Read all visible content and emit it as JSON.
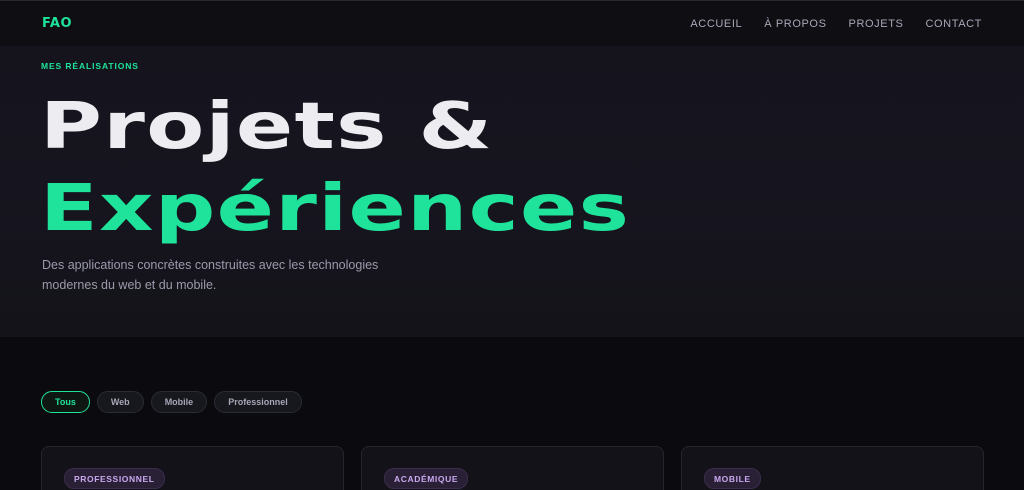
{
  "nav": {
    "logo": "FAO",
    "links": [
      "ACCUEIL",
      "À PROPOS",
      "PROJETS",
      "CONTACT"
    ]
  },
  "hero": {
    "eyebrow": "MES RÉALISATIONS",
    "title_line1": "Projets &",
    "title_line2": "Expériences",
    "subtitle": "Des applications concrètes construites avec les technologies modernes du web et du mobile."
  },
  "filters": {
    "items": [
      "Tous",
      "Web",
      "Mobile",
      "Professionnel"
    ],
    "active": "Tous"
  },
  "cards": [
    {
      "badge": "PROFESSIONNEL"
    },
    {
      "badge": "ACADÉMIQUE"
    },
    {
      "badge": "MOBILE"
    }
  ],
  "colors": {
    "accent": "#1fe39a",
    "background": "#0b0b0f",
    "badge_text": "#c9a8ef"
  }
}
